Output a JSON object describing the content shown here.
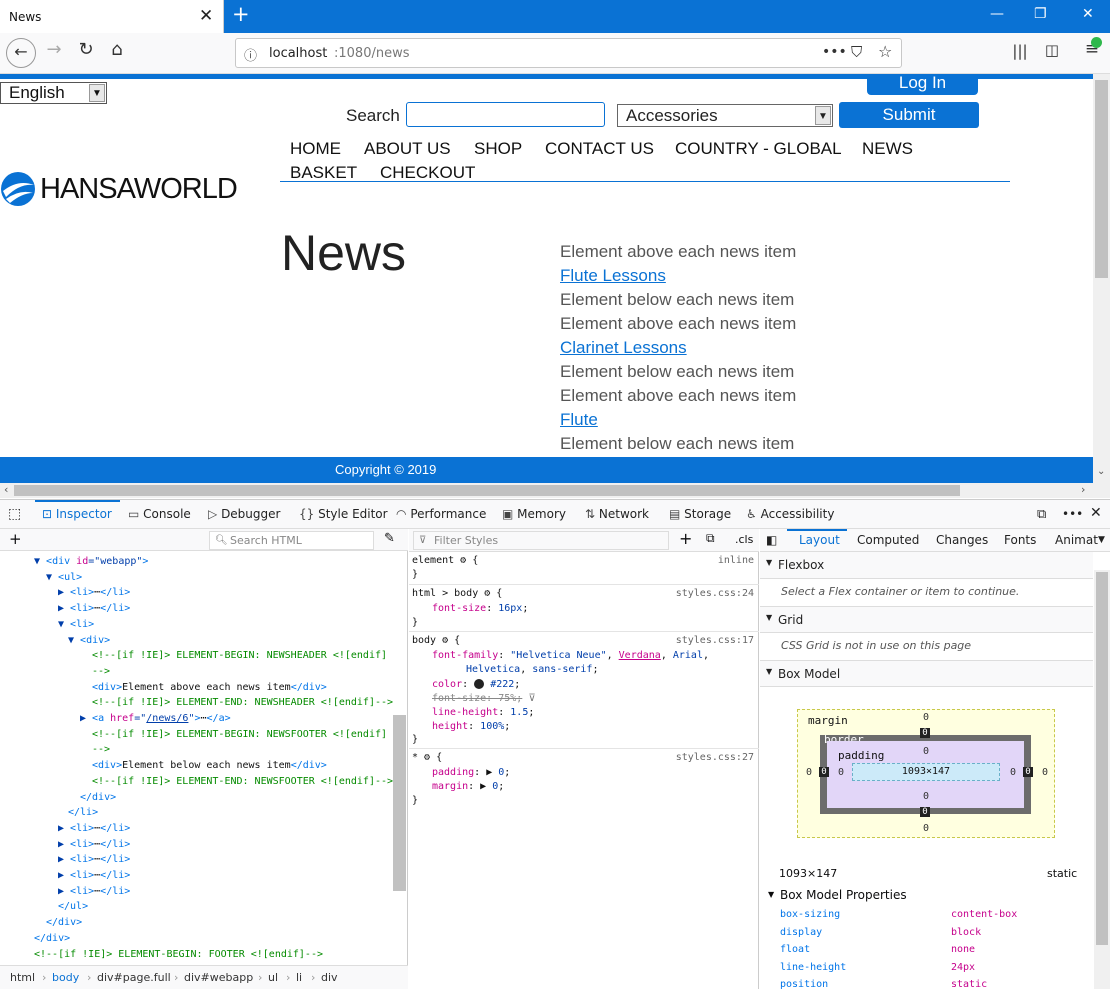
{
  "browser": {
    "tab_title": "News",
    "tab_close": "✕",
    "new_tab": "+",
    "url_host": "localhost",
    "url_path": ":1080/news",
    "window_buttons": [
      "—",
      "❐",
      "✕"
    ]
  },
  "page": {
    "language": "English",
    "login_label": "Log In",
    "search_label": "Search",
    "category": "Accessories",
    "submit_label": "Submit",
    "menu": [
      "HOME",
      "ABOUT US",
      "SHOP",
      "CONTACT US",
      "COUNTRY - GLOBAL",
      "NEWS",
      "BASKET",
      "CHECKOUT"
    ],
    "logo_text": "HANSAWORLD",
    "title": "News",
    "news_lines": [
      {
        "text": "Element above each news item",
        "link": false
      },
      {
        "text": "Flute Lessons",
        "link": true
      },
      {
        "text": "Element below each news item",
        "link": false
      },
      {
        "text": "Element above each news item",
        "link": false
      },
      {
        "text": "Clarinet Lessons",
        "link": true
      },
      {
        "text": "Element below each news item",
        "link": false
      },
      {
        "text": "Element above each news item",
        "link": false
      },
      {
        "text": "Flute",
        "link": true
      },
      {
        "text": "Element below each news item",
        "link": false
      }
    ],
    "copyright": "Copyright © 2019"
  },
  "devtools": {
    "tabs": [
      "Inspector",
      "Console",
      "Debugger",
      "Style Editor",
      "Performance",
      "Memory",
      "Network",
      "Storage",
      "Accessibility"
    ],
    "search_html_placeholder": "Search HTML",
    "filter_styles_placeholder": "Filter Styles",
    "cls_label": ".cls",
    "breadcrumb": [
      "html",
      "body",
      "div#page.full",
      "div#webapp",
      "ul",
      "li",
      "div"
    ],
    "layout_tabs": [
      "Layout",
      "Computed",
      "Changes",
      "Fonts",
      "Animat"
    ],
    "flexbox_label": "Flexbox",
    "flexbox_note": "Select a Flex container or item to continue.",
    "grid_label": "Grid",
    "grid_note": "CSS Grid is not in use on this page",
    "boxmodel_label": "Box Model",
    "bm_margin_label": "margin",
    "bm_border_label": "border",
    "bm_padding_label": "padding",
    "bm_content": "1093×147",
    "bm_zero": "0",
    "bm_size": "1093×147",
    "bm_position": "static",
    "bm_props_label": "Box Model Properties",
    "bm_props": [
      {
        "name": "box-sizing",
        "value": "content-box"
      },
      {
        "name": "display",
        "value": "block"
      },
      {
        "name": "float",
        "value": "none"
      },
      {
        "name": "line-height",
        "value": "24px"
      },
      {
        "name": "position",
        "value": "static"
      }
    ]
  }
}
